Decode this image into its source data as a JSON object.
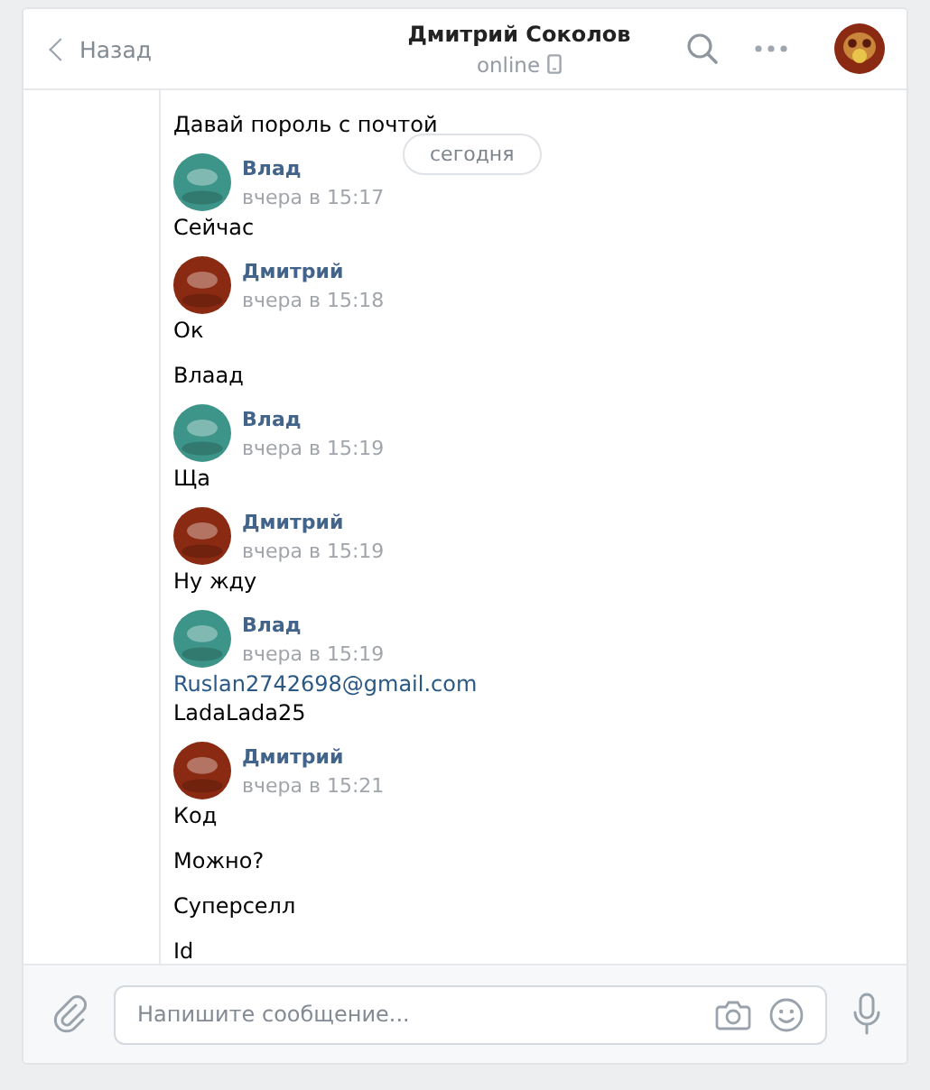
{
  "header": {
    "back": "Назад",
    "title": "Дмитрий Соколов",
    "status": "online"
  },
  "date_divider": "сегодня",
  "messages": [
    {
      "text": "Давай пороль с почтой",
      "kind": "text"
    }
  ],
  "groups": [
    {
      "author": "Влад",
      "time": "вчера в 15:17",
      "color": "#3d9488",
      "messages": [
        {
          "text": "Сейчас",
          "kind": "text"
        }
      ]
    },
    {
      "author": "Дмитрий",
      "time": "вчера в 15:18",
      "color": "#8a2a12",
      "messages": [
        {
          "text": "Ок",
          "kind": "text"
        },
        {
          "text": "Влаад",
          "kind": "text"
        }
      ]
    },
    {
      "author": "Влад",
      "time": "вчера в 15:19",
      "color": "#3d9488",
      "messages": [
        {
          "text": "Ща",
          "kind": "text"
        }
      ]
    },
    {
      "author": "Дмитрий",
      "time": "вчера в 15:19",
      "color": "#8a2a12",
      "messages": [
        {
          "text": "Ну жду",
          "kind": "text"
        }
      ]
    },
    {
      "author": "Влад",
      "time": "вчера в 15:19",
      "color": "#3d9488",
      "messages": [
        {
          "text": "Ruslan2742698@gmail.com",
          "kind": "link"
        },
        {
          "text": "LadaLada25",
          "kind": "text"
        }
      ]
    },
    {
      "author": "Дмитрий",
      "time": "вчера в 15:21",
      "color": "#8a2a12",
      "messages": [
        {
          "text": "Код",
          "kind": "text"
        },
        {
          "text": "Можно?",
          "kind": "text"
        },
        {
          "text": "Суперселл",
          "kind": "text"
        },
        {
          "text": "Id",
          "kind": "text"
        }
      ]
    }
  ],
  "composer": {
    "placeholder": "Напишите сообщение..."
  }
}
